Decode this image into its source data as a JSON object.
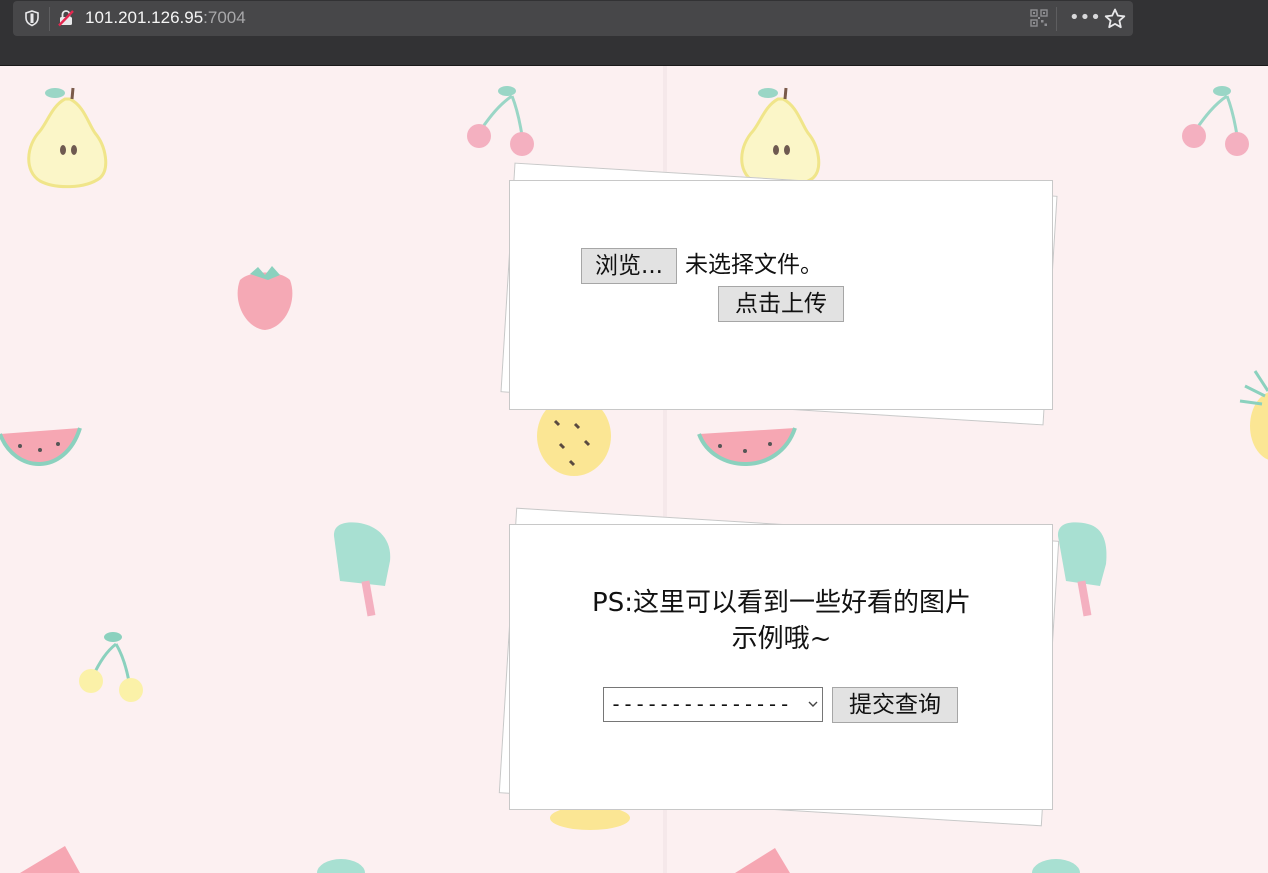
{
  "browser": {
    "url_host": "101.201.126.95",
    "url_port": ":7004",
    "more_label": "•••"
  },
  "upload_card": {
    "browse_label": "浏览...",
    "file_status": "未选择文件。",
    "upload_label": "点击上传"
  },
  "query_card": {
    "ps_line1": "PS:这里可以看到一些好看的图片",
    "ps_line2": "示例哦~",
    "select_value": "---------------",
    "submit_label": "提交查询"
  },
  "colors": {
    "page_bg": "#fcf0f1",
    "toolbar_bg": "#323234",
    "urlbar_bg": "#474749"
  },
  "icons": [
    "shield-icon",
    "insecure-lock-icon",
    "qr-code-icon",
    "more-icon",
    "star-icon",
    "chevron-down-icon"
  ]
}
